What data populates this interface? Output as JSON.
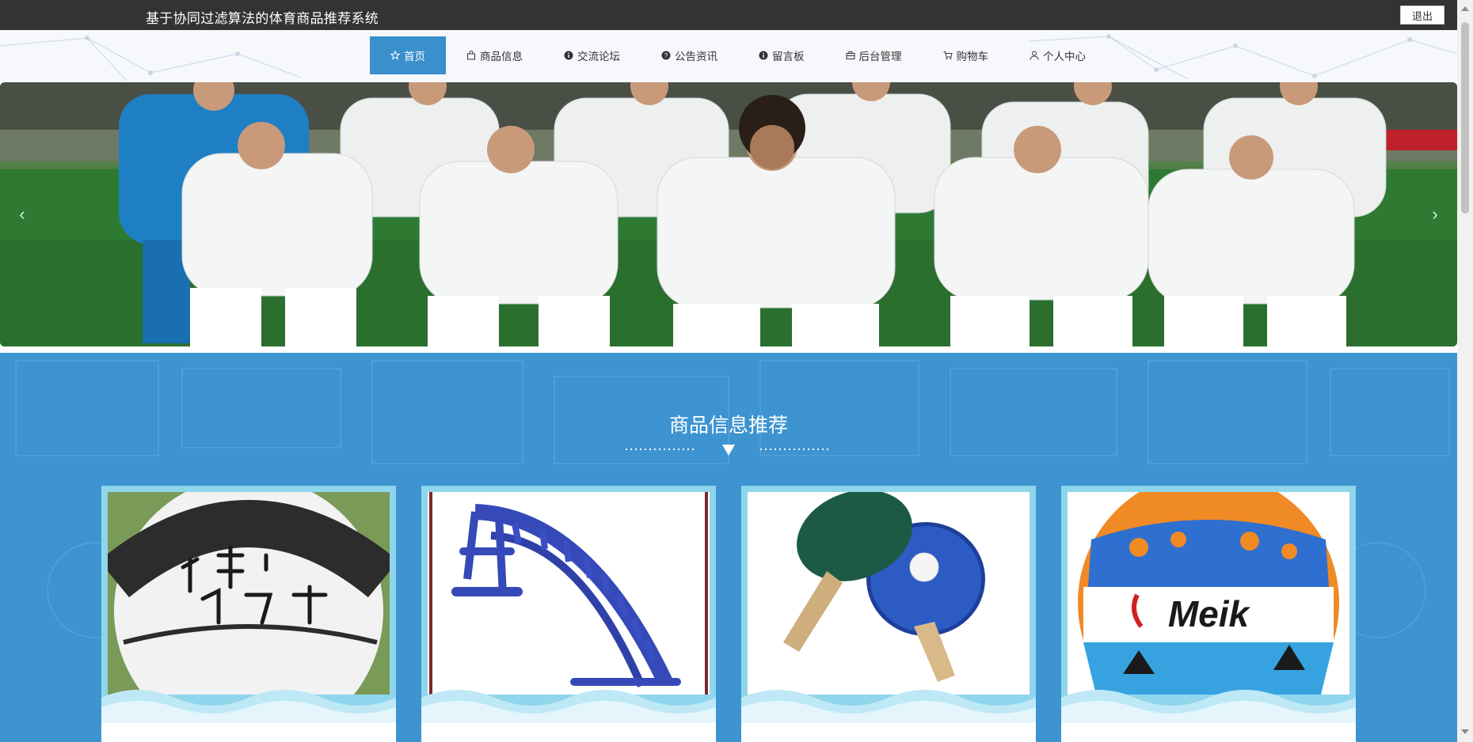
{
  "header": {
    "site_title": "基于协同过滤算法的体育商品推荐系统",
    "logout_label": "退出",
    "bar_color": "#333333"
  },
  "nav": {
    "items": [
      {
        "label": "首页",
        "icon": "star-icon",
        "active": true
      },
      {
        "label": "商品信息",
        "icon": "bag-icon",
        "active": false
      },
      {
        "label": "交流论坛",
        "icon": "info-icon",
        "active": false
      },
      {
        "label": "公告资讯",
        "icon": "question-icon",
        "active": false
      },
      {
        "label": "留言板",
        "icon": "info-icon",
        "active": false
      },
      {
        "label": "后台管理",
        "icon": "briefcase-icon",
        "active": false
      },
      {
        "label": "购物车",
        "icon": "cart-icon",
        "active": false
      },
      {
        "label": "个人中心",
        "icon": "user-icon",
        "active": false
      }
    ],
    "active_color": "#3a8fcd"
  },
  "banner": {
    "slides": 3,
    "active_slide": 1,
    "prev_icon": "chevron-left-icon",
    "next_icon": "chevron-right-icon"
  },
  "recommend": {
    "title": "商品信息推荐",
    "background": "#3d94d1",
    "products": [
      {
        "image": "basketball-image"
      },
      {
        "image": "sit-up-bench-image"
      },
      {
        "image": "ping-pong-paddles-image"
      },
      {
        "image": "volleyball-image"
      }
    ]
  }
}
